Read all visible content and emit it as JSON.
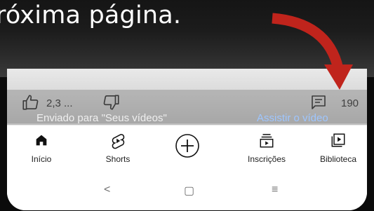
{
  "caption": "róxima página.",
  "video": {
    "like_count": "2,3 ...",
    "comment_count": "190",
    "upload_text": "Enviado para \"Seus vídeos\"",
    "watch_link": "Assistir o vídeo"
  },
  "nav": {
    "items": [
      {
        "label": "Início",
        "icon": "home-icon"
      },
      {
        "label": "Shorts",
        "icon": "shorts-icon"
      },
      {
        "label": "",
        "icon": "create-plus-icon"
      },
      {
        "label": "Inscrições",
        "icon": "subscriptions-icon"
      },
      {
        "label": "Biblioteca",
        "icon": "library-icon"
      }
    ]
  },
  "system_nav": {
    "back": "<",
    "home": "▢",
    "recents": "≡"
  },
  "colors": {
    "arrow": "#c0241c",
    "link": "#9ec6ff"
  }
}
